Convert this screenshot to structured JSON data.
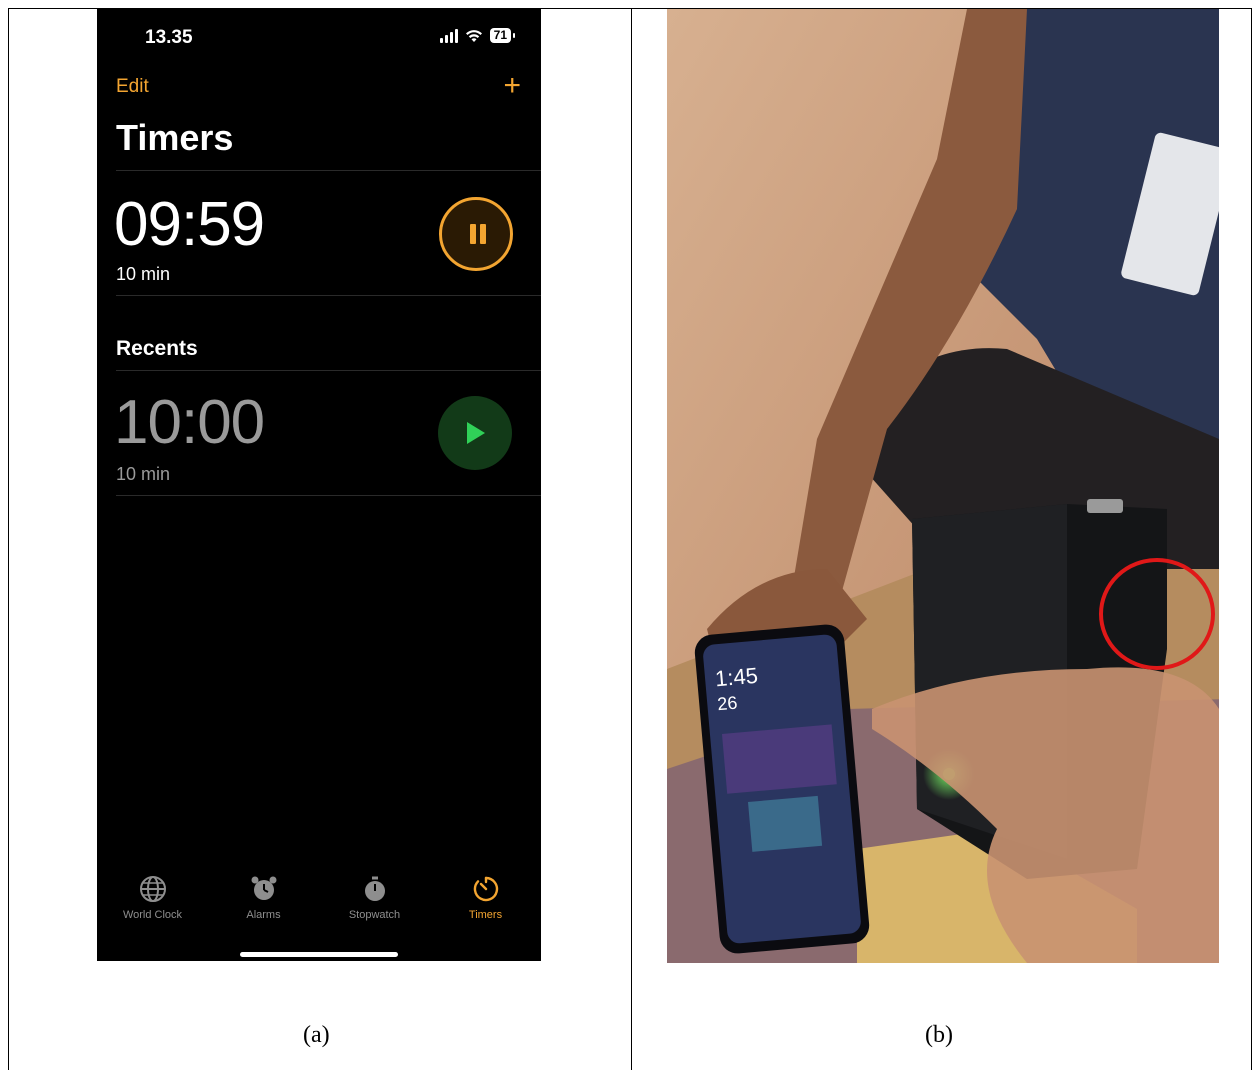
{
  "panel_a": {
    "status_time": "13.35",
    "battery": "71",
    "edit_label": "Edit",
    "add_label": "+",
    "title": "Timers",
    "active_timer": {
      "time": "09:59",
      "label": "10 min"
    },
    "recents_header": "Recents",
    "recent_timer": {
      "time": "10:00",
      "label": "10 min"
    },
    "tabs": [
      {
        "label": "World Clock",
        "icon": "globe-icon"
      },
      {
        "label": "Alarms",
        "icon": "alarm-clock-icon"
      },
      {
        "label": "Stopwatch",
        "icon": "stopwatch-icon"
      },
      {
        "label": "Timers",
        "icon": "timer-icon"
      }
    ],
    "accent_color": "#f3a531",
    "play_color": "#30d158"
  },
  "panel_b": {
    "phone_time": "1:45",
    "phone_temp": "26",
    "highlight_color": "#e01818"
  },
  "captions": {
    "a": "(a)",
    "b": "(b)"
  }
}
